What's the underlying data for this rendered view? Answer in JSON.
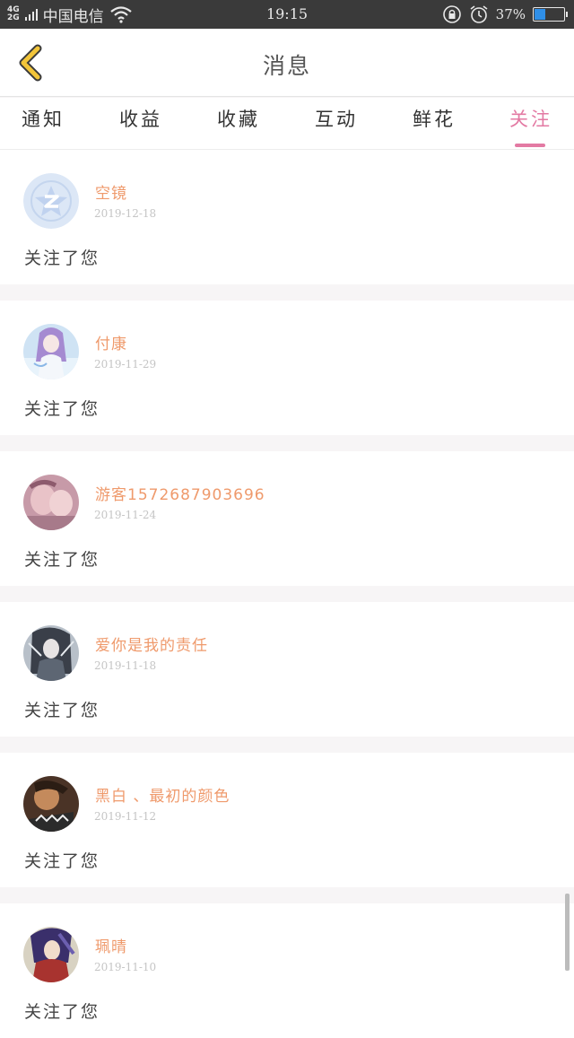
{
  "status": {
    "carrier": "中国电信",
    "net_top": "4G",
    "net_bottom": "2G",
    "time": "19:15",
    "battery_text": "37%",
    "battery_level": 0.37,
    "icons": [
      "signal-icon",
      "wifi-icon",
      "lock-rotation-icon",
      "alarm-icon",
      "battery-icon"
    ]
  },
  "header": {
    "title": "消息",
    "back_icon": "chevron-left-icon",
    "accent": "#f2c53a"
  },
  "tabs": [
    {
      "label": "通知"
    },
    {
      "label": "收益"
    },
    {
      "label": "收藏"
    },
    {
      "label": "互动"
    },
    {
      "label": "鲜花"
    },
    {
      "label": "关注",
      "active": true
    }
  ],
  "colors": {
    "active_tab": "#e37aa3",
    "name": "#ef9a6c",
    "date": "#c5c5c5",
    "separator": "#f7f5f6"
  },
  "notifications": [
    {
      "name": "空镜",
      "date": "2019-12-18",
      "message": "关注了您",
      "avatar": "qq-default-avatar"
    },
    {
      "name": "付康",
      "date": "2019-11-29",
      "message": "关注了您",
      "avatar": "anime-girl-avatar"
    },
    {
      "name": "游客1572687903696",
      "date": "2019-11-24",
      "message": "关注了您",
      "avatar": "photo-avatar"
    },
    {
      "name": "爱你是我的责任",
      "date": "2019-11-18",
      "message": "关注了您",
      "avatar": "anime-avatar"
    },
    {
      "name": "黑白 、最初的颜色",
      "date": "2019-11-12",
      "message": "关注了您",
      "avatar": "dark-avatar"
    },
    {
      "name": "珮晴",
      "date": "2019-11-10",
      "message": "关注了您",
      "avatar": "anime-boy-avatar"
    }
  ]
}
